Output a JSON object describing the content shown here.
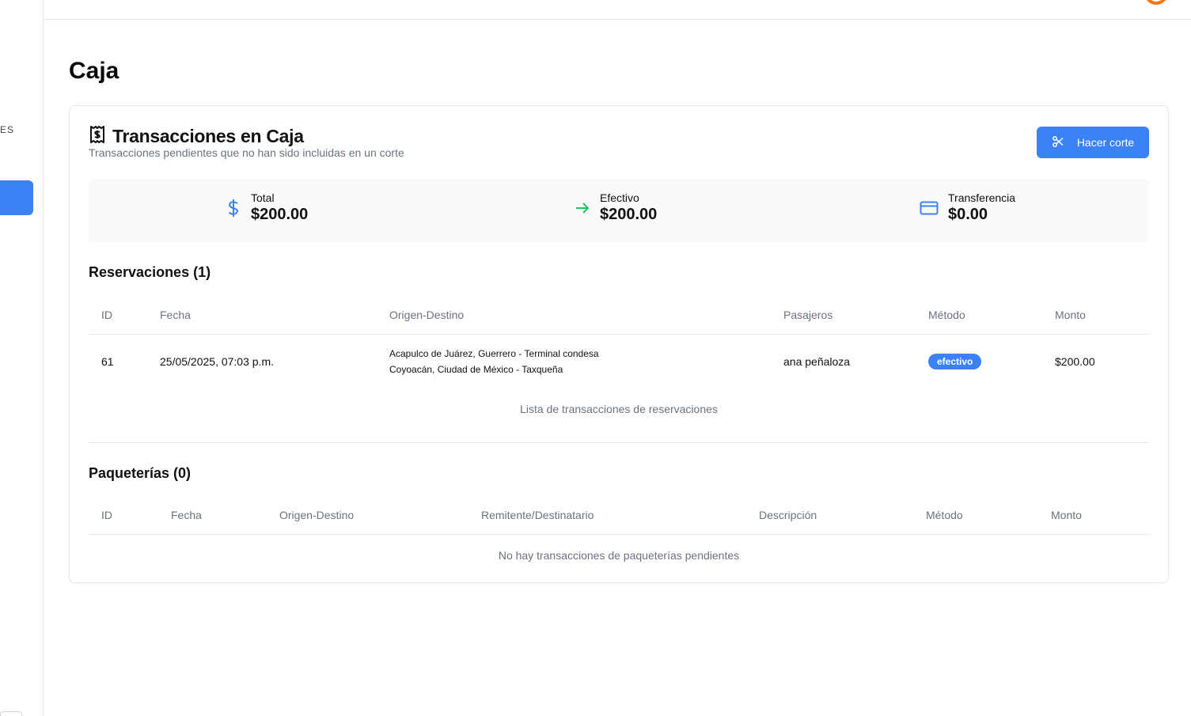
{
  "sidebar": {
    "section_label": "ES"
  },
  "page": {
    "title": "Caja"
  },
  "card": {
    "title": "Transacciones en Caja",
    "subtitle": "Transacciones pendientes que no han sido incluidas en un corte",
    "cut_button_label": "Hacer corte"
  },
  "summary": {
    "total": {
      "label": "Total",
      "value": "$200.00",
      "icon": "dollar-icon"
    },
    "cash": {
      "label": "Efectivo",
      "value": "$200.00",
      "icon": "arrow-right-icon"
    },
    "transfer": {
      "label": "Transferencia",
      "value": "$0.00",
      "icon": "credit-card-icon"
    }
  },
  "reservations": {
    "title": "Reservaciones (1)",
    "columns": [
      "ID",
      "Fecha",
      "Origen-Destino",
      "Pasajeros",
      "Método",
      "Monto"
    ],
    "rows": [
      {
        "id": "61",
        "date": "25/05/2025, 07:03 p.m.",
        "origin": "Acapulco de Juárez, Guerrero - Terminal condesa",
        "destination": "Coyoacán, Ciudad de México - Taxqueña",
        "passengers": "ana peñaloza",
        "method": "efectivo",
        "amount": "$200.00"
      }
    ],
    "caption": "Lista de transacciones de reservaciones"
  },
  "packages": {
    "title": "Paqueterías (0)",
    "columns": [
      "ID",
      "Fecha",
      "Origen-Destino",
      "Remitente/Destinatario",
      "Descripción",
      "Método",
      "Monto"
    ],
    "empty_message": "No hay transacciones de paqueterías pendientes"
  },
  "colors": {
    "accent": "#3b82f6",
    "cash_icon": "#22c55e",
    "avatar_ring": "#f97316"
  }
}
